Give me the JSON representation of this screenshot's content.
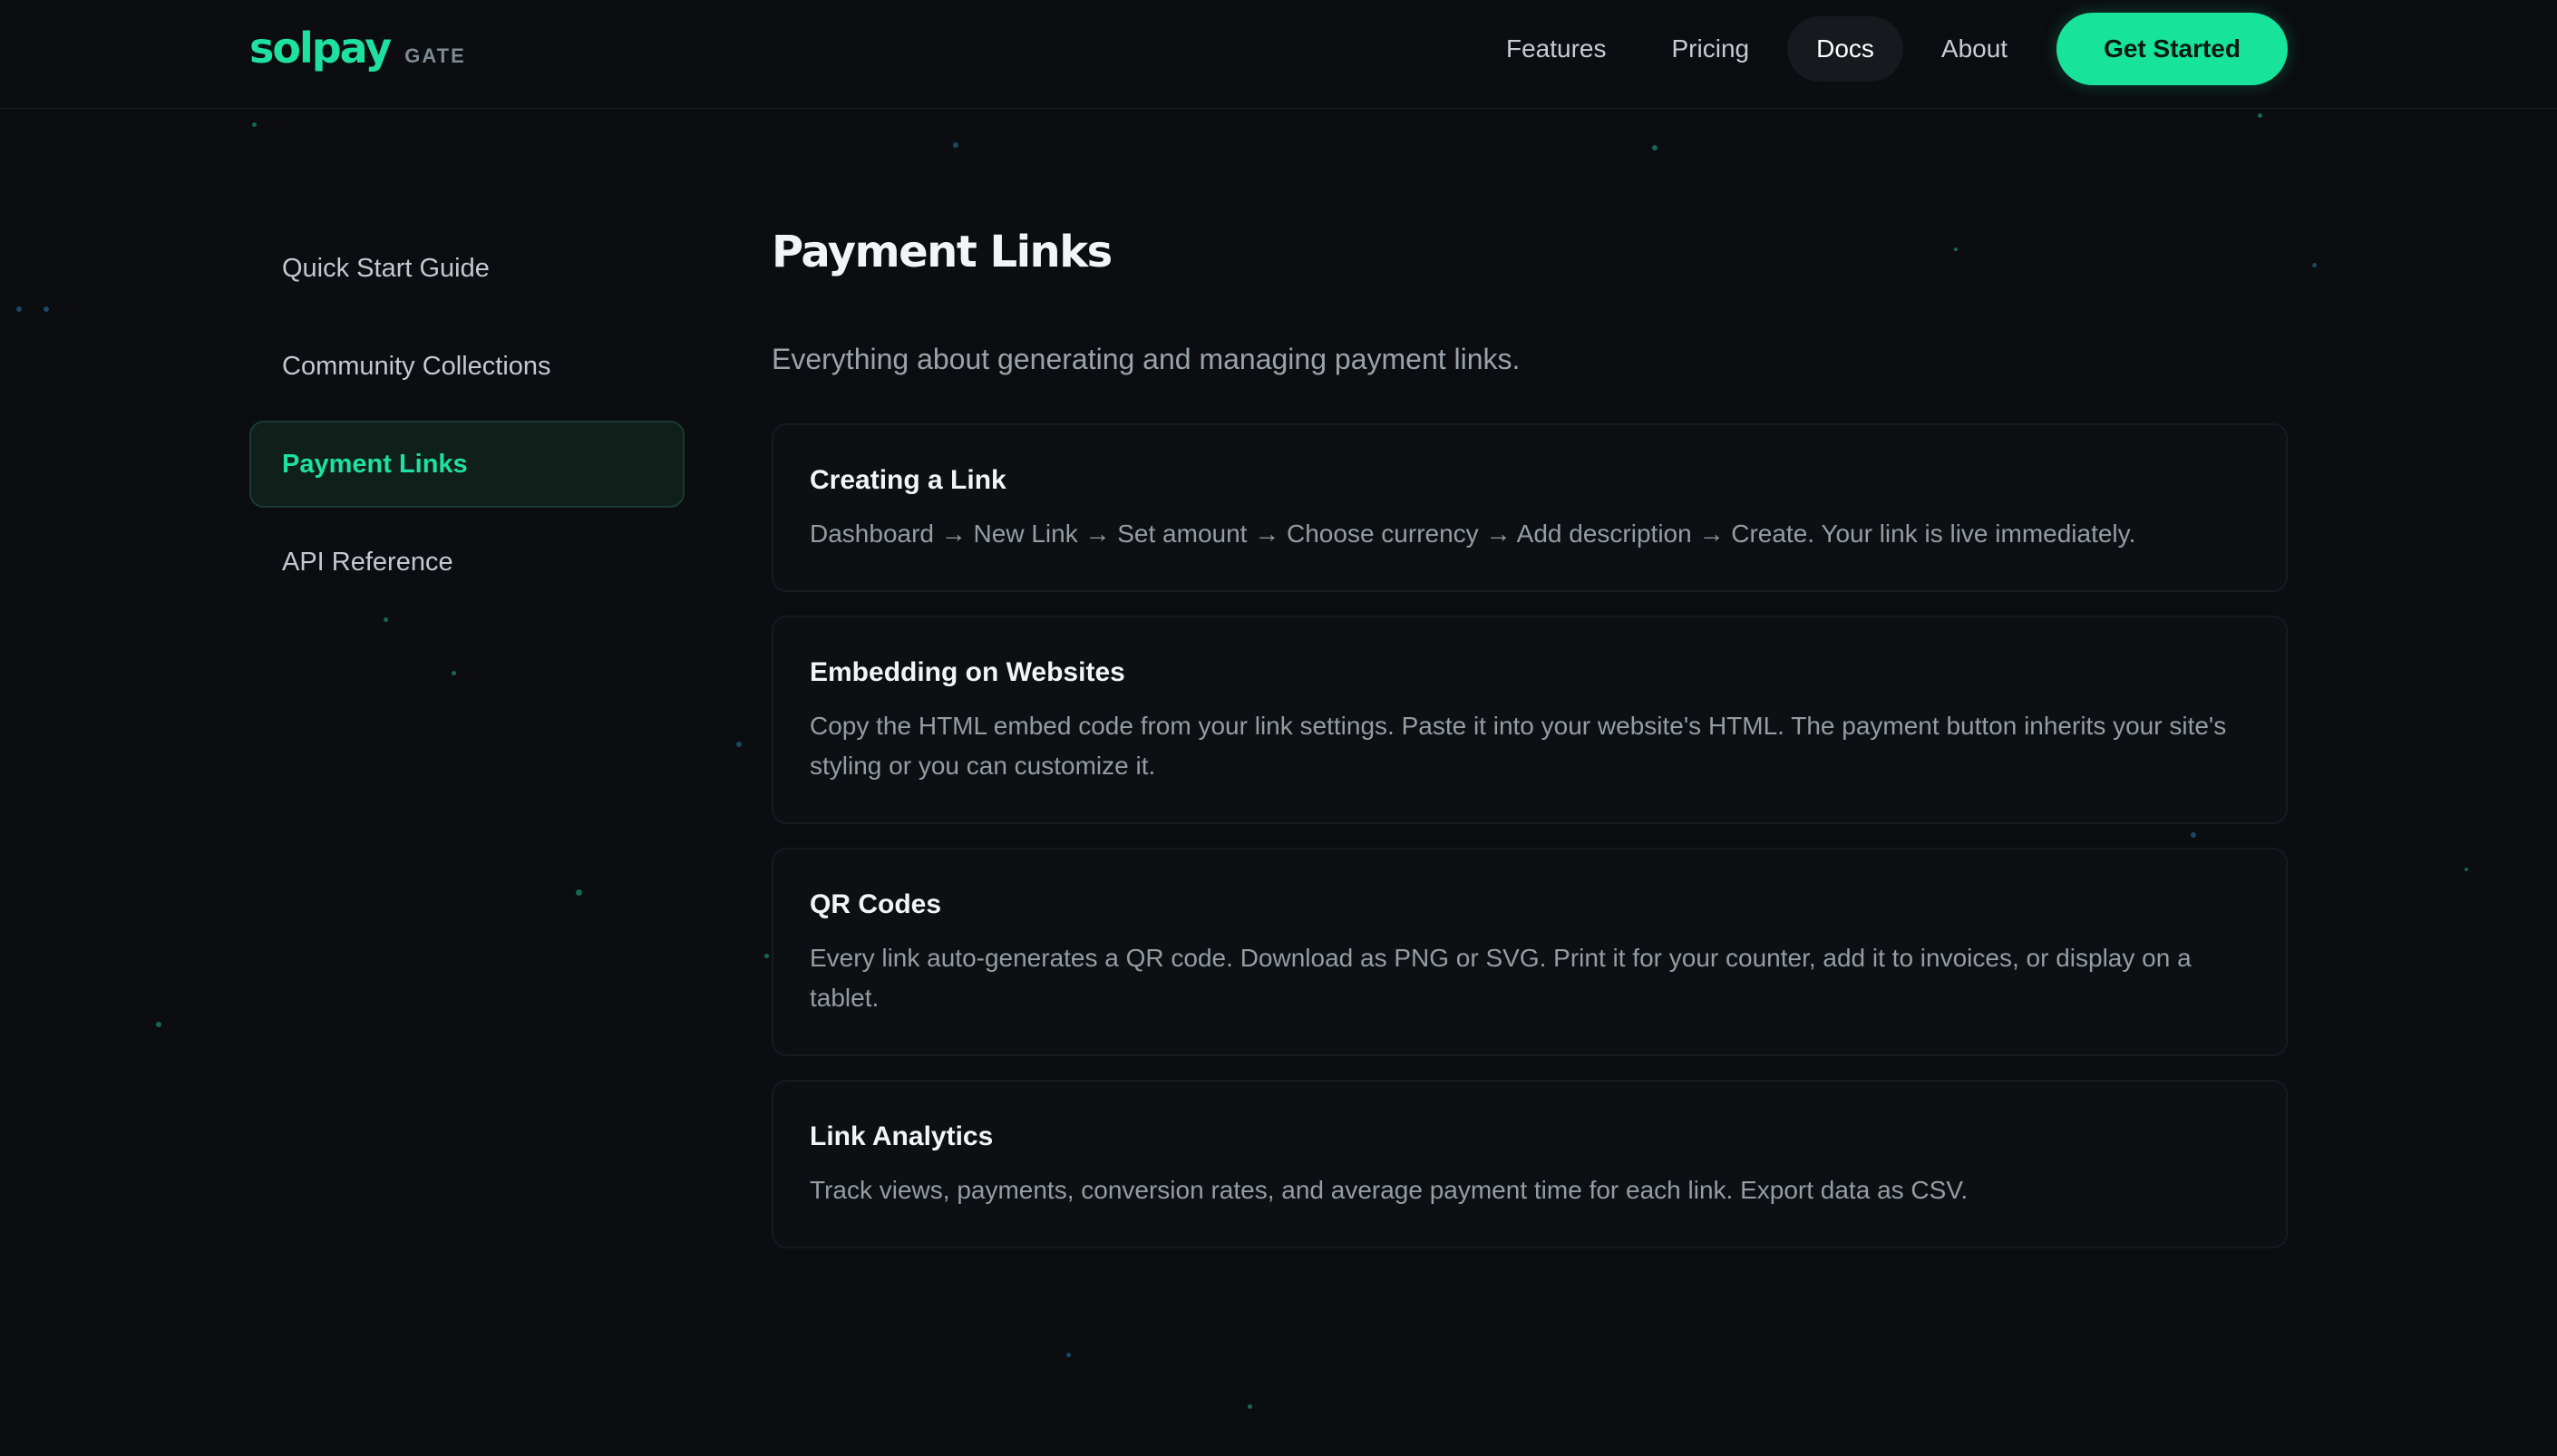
{
  "brand": {
    "name": "solpay",
    "sub": "GATE",
    "accent": "#18e39a"
  },
  "nav": {
    "items": [
      "Features",
      "Pricing",
      "Docs",
      "About"
    ],
    "active": "Docs",
    "cta": "Get Started"
  },
  "sidebar": {
    "items": [
      "Quick Start Guide",
      "Community Collections",
      "Payment Links",
      "API Reference"
    ],
    "active": "Payment Links"
  },
  "main": {
    "title": "Payment Links",
    "subtitle": "Everything about generating and managing payment links.",
    "cards": [
      {
        "title": "Creating a Link",
        "body": "Dashboard → New Link → Set amount → Choose currency → Add description → Create. Your link is live immediately."
      },
      {
        "title": "Embedding on Websites",
        "body": "Copy the HTML embed code from your link settings. Paste it into your website's HTML. The payment button inherits your site's styling or you can customize it."
      },
      {
        "title": "QR Codes",
        "body": "Every link auto-generates a QR code. Download as PNG or SVG. Print it for your counter, add it to invoices, or display on a tablet."
      },
      {
        "title": "Link Analytics",
        "body": "Track views, payments, conversion rates, and average payment time for each link. Export data as CSV."
      }
    ]
  }
}
